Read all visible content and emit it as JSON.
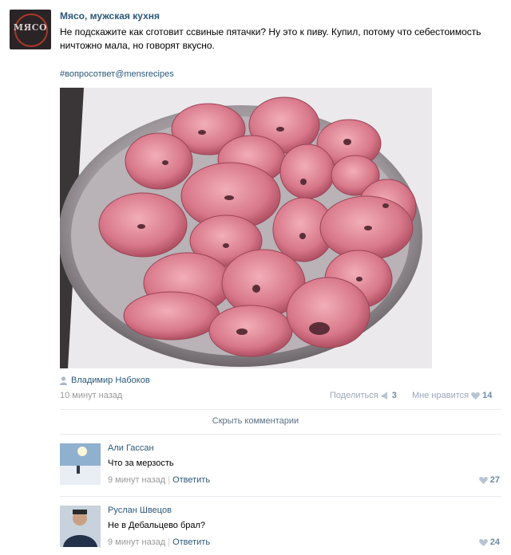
{
  "group": {
    "name": "Мясо, мужская кухня",
    "logo_text": "МЯСО"
  },
  "post": {
    "text": "Не подскажите как сготовит ссвиные пятачки? Ну это к пиву. Купил, потому что себестоимость ничтожно мала, но говорят вкусно.",
    "hashtag": "#вопросответ@mensrecipes",
    "author": "Владимир Набоков",
    "time": "10 минут назад",
    "share_label": "Поделиться",
    "share_count": "3",
    "like_label": "Мне нравится",
    "like_count": "14"
  },
  "hide_comments_label": "Скрыть комментарии",
  "comments": [
    {
      "author": "Али Гассан",
      "text": "Что за мерзость",
      "time": "9 минут назад",
      "reply_label": "Ответить",
      "likes": "27"
    },
    {
      "author": "Руслан Швецов",
      "text": "Не в Дебальцево брал?",
      "time": "9 минут назад",
      "reply_label": "Ответить",
      "likes": "24"
    }
  ],
  "colors": {
    "link": "#2b587a",
    "muted": "#999999",
    "like": "#6c8ba6"
  },
  "icons": {
    "user": "user-icon",
    "share": "megaphone-icon",
    "like": "heart-icon"
  }
}
